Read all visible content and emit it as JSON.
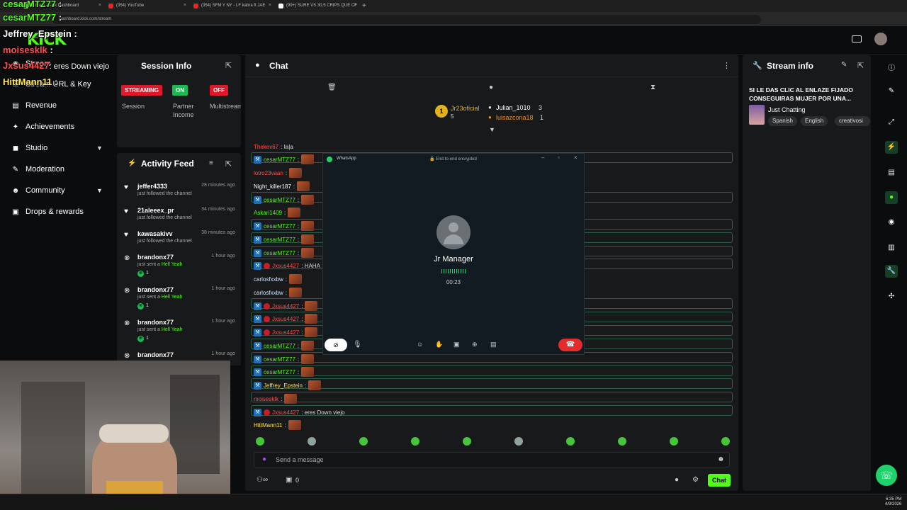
{
  "browser": {
    "tabs": [
      {
        "label": "Stream - Kick Dashboard",
        "color": "#53fc18"
      },
      {
        "label": "(354) YouTube",
        "color": "#e22"
      },
      {
        "label": "(354) SFM Y NY - LF kabra ft JAE",
        "color": "#e22"
      },
      {
        "label": "(99+) SURE VS 30,5 CRIPS QUE CF",
        "color": "#fff"
      }
    ],
    "url": "dashboard.kick.com/stream",
    "new_tab": "+"
  },
  "overlay_chat": [
    {
      "user": "cesarMTZ77",
      "color": "#53fc18",
      "msg": ""
    },
    {
      "user": "cesarMTZ77",
      "color": "#53fc18",
      "msg": ""
    },
    {
      "user": "Jeffrey_Epstein",
      "color": "#ffffff",
      "msg": ""
    },
    {
      "user": "moisesklk",
      "color": "#ff4f4f",
      "msg": ""
    },
    {
      "user": "Jxsus4427",
      "color": "#ff4f4f",
      "msg": ": eres Down viejo"
    },
    {
      "user": "HittMann11",
      "color": "#ffe54f",
      "msg": ""
    }
  ],
  "logo": "KICK",
  "sidebar": {
    "items": [
      {
        "label": "Stream",
        "icon": "broadcast-icon"
      },
      {
        "label": "Stream URL & Key",
        "icon": "key-icon"
      },
      {
        "label": "Revenue",
        "icon": "money-icon"
      },
      {
        "label": "Achievements",
        "icon": "trophy-icon"
      },
      {
        "label": "Studio",
        "icon": "studio-icon"
      },
      {
        "label": "Moderation",
        "icon": "gavel-icon"
      },
      {
        "label": "Community",
        "icon": "people-icon"
      },
      {
        "label": "Drops & rewards",
        "icon": "gift-icon"
      }
    ]
  },
  "session": {
    "title": "Session Info",
    "items": [
      {
        "badge": "STREAMING",
        "badge_color": "#e0182b",
        "label": "Session"
      },
      {
        "badge": "ON",
        "badge_color": "#1db954",
        "label": "Partner Income"
      },
      {
        "badge": "OFF",
        "badge_color": "#e0182b",
        "label": "Multistream"
      }
    ]
  },
  "activity": {
    "title": "Activity Feed",
    "items": [
      {
        "user": "jeffer4333",
        "time": "28 minutes ago",
        "text": "just followed the channel",
        "gift": ""
      },
      {
        "user": "21aleeex_pr",
        "time": "34 minutes ago",
        "text": "just followed the channel",
        "gift": ""
      },
      {
        "user": "kawasakivv",
        "time": "38 minutes ago",
        "text": "just followed the channel",
        "gift": ""
      },
      {
        "user": "brandonx77",
        "time": "1 hour ago",
        "text": "just sent a",
        "gift": "Hell Yeah",
        "count": "1"
      },
      {
        "user": "brandonx77",
        "time": "1 hour ago",
        "text": "just sent a",
        "gift": "Hell Yeah",
        "count": "1"
      },
      {
        "user": "brandonx77",
        "time": "1 hour ago",
        "text": "just sent a",
        "gift": "Hell Yeah",
        "count": "1"
      },
      {
        "user": "brandonx77",
        "time": "1 hour ago",
        "text": "",
        "gift": ""
      }
    ],
    "extra_times": [
      "ago",
      "ago",
      "ago",
      "ago",
      "ago",
      "ago"
    ]
  },
  "chat": {
    "title": "Chat",
    "leaders": {
      "first": {
        "user": "Jr23oficial",
        "count": "5"
      },
      "second": {
        "user": "Julian_1010",
        "count": "3"
      },
      "third": {
        "user": "luisazcona18",
        "count": "1"
      }
    },
    "lines": [
      {
        "user": "Thekev67",
        "color": "#ff4f4f",
        "msg": ": Ia|a",
        "mod": false
      },
      {
        "user": "cesarMTZ77",
        "color": "#53fc18",
        "msg": "",
        "mod": true
      },
      {
        "user": "lotro23vaan",
        "color": "#ff4f4f",
        "msg": "",
        "mod": false
      },
      {
        "user": "Night_killer187",
        "color": "#ffffff",
        "msg": "",
        "mod": false
      },
      {
        "user": "cesarMTZ77",
        "color": "#53fc18",
        "msg": "",
        "mod": true
      },
      {
        "user": "Askari1409",
        "color": "#53fc18",
        "msg": "",
        "mod": false
      },
      {
        "user": "cesarMTZ77",
        "color": "#53fc18",
        "msg": "",
        "mod": true
      },
      {
        "user": "cesarMTZ77",
        "color": "#53fc18",
        "msg": "",
        "mod": true
      },
      {
        "user": "cesarMTZ77",
        "color": "#53fc18",
        "msg": "",
        "mod": true
      },
      {
        "user": "Jxsus4427",
        "color": "#ff4f4f",
        "msg": ": HAHA",
        "mod": true
      },
      {
        "user": "carlosfxxbw",
        "color": "#cfe6ff",
        "msg": "",
        "mod": false
      },
      {
        "user": "carlosfxxbw",
        "color": "#cfe6ff",
        "msg": "",
        "mod": false
      },
      {
        "user": "Jxsus4427",
        "color": "#ff4f4f",
        "msg": "",
        "mod": true
      },
      {
        "user": "Jxsus4427",
        "color": "#ff4f4f",
        "msg": "",
        "mod": true
      },
      {
        "user": "Jxsus4427",
        "color": "#ff4f4f",
        "msg": "",
        "mod": true
      },
      {
        "user": "cesarMTZ77",
        "color": "#53fc18",
        "msg": "",
        "mod": true
      },
      {
        "user": "cesarMTZ77",
        "color": "#53fc18",
        "msg": "",
        "mod": true
      },
      {
        "user": "cesarMTZ77",
        "color": "#53fc18",
        "msg": "",
        "mod": true
      },
      {
        "user": "Jeffrey_Epstein",
        "color": "#ffe54f",
        "msg": "",
        "mod": true
      },
      {
        "user": "moisesklk",
        "color": "#ff4f4f",
        "msg": "",
        "mod": false
      },
      {
        "user": "Jxsus4427",
        "color": "#ff4f4f",
        "msg": ": eres Down viejo",
        "mod": true
      },
      {
        "user": "HittMann11",
        "color": "#ffe54f",
        "msg": "",
        "mod": false
      }
    ],
    "placeholder": "Send a message",
    "send_label": "Chat",
    "viewer_count": "0"
  },
  "whatsapp": {
    "app": "WhatsApp",
    "encryption": "End-to-end encrypted",
    "contact": "Jr Manager",
    "duration": "00:23"
  },
  "stream_info": {
    "title": "Stream info",
    "stream_title": "SI LE DAS CLIC AL ENLAZE FIJADO CONSEGUIRAS MUJER POR UNA...",
    "category": "Just Chatting",
    "tags": [
      "Spanish",
      "English",
      "creativosi"
    ]
  },
  "taskbar": {
    "time": "6:35 PM",
    "date": "4/9/2026"
  },
  "accent": "#53fc18"
}
